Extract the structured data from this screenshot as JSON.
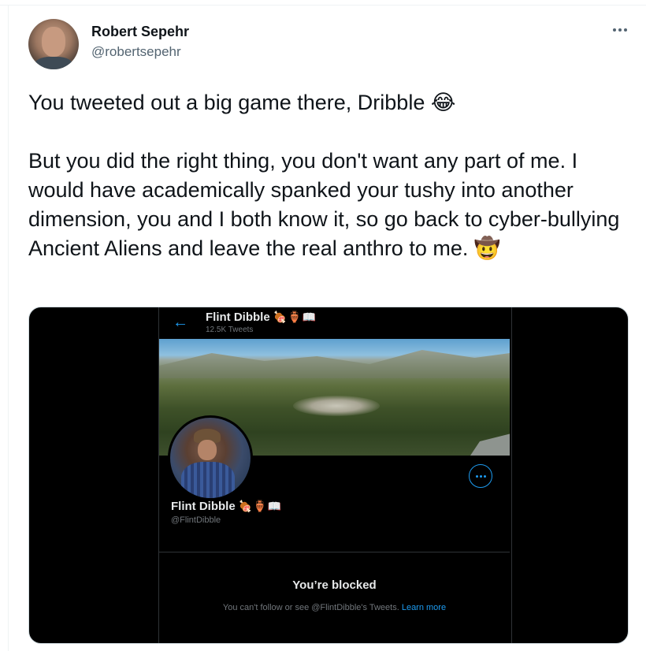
{
  "tweet": {
    "author_name": "Robert Sepehr",
    "author_handle": "@robertsepehr",
    "more_icon": "more-horizontal-icon",
    "text_line1": "You tweeted out a big game there, Dribble 😂",
    "text_body": "But you did the right thing, you don't want any part of me. I would have academically spanked your tushy into another dimension, you and I both know it, so go back to cyber-bullying Ancient Aliens and leave the real anthro to me. 🤠"
  },
  "embedded_screenshot": {
    "header": {
      "back_icon": "←",
      "name": "Flint Dibble",
      "emojis": "🍖🏺📖",
      "tweets_count": "12.5K Tweets"
    },
    "profile": {
      "name": "Flint Dibble",
      "emojis": "🍖🏺📖",
      "handle": "@FlintDibble"
    },
    "blocked": {
      "title": "You’re blocked",
      "message": "You can't follow or see @FlintDibble's Tweets.",
      "link": "Learn more"
    }
  },
  "colors": {
    "accent": "#1d9bf0",
    "text_primary": "#0f1419",
    "text_secondary": "#536471",
    "dark_bg": "#000000"
  }
}
